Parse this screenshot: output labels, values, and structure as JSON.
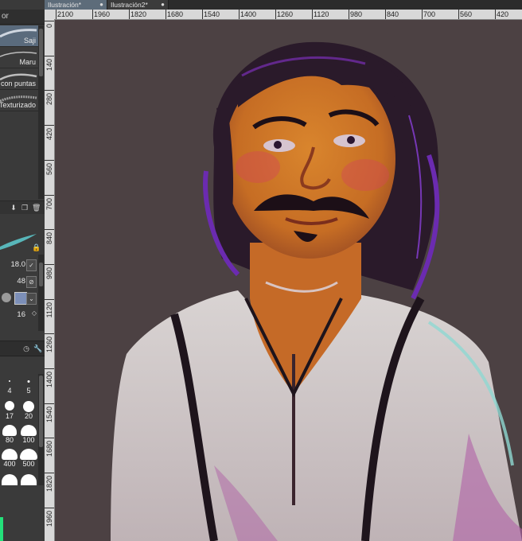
{
  "tabs": [
    {
      "label": "Ilustración*",
      "close": "●",
      "active": true
    },
    {
      "label": "Ilustración2*",
      "close": "●",
      "active": false
    }
  ],
  "ruler_top_labels": [
    "2100",
    "1960",
    "1820",
    "1680",
    "1540",
    "1400",
    "1260",
    "1120",
    "980",
    "840",
    "700",
    "560",
    "420"
  ],
  "ruler_left_labels": [
    "0",
    "140",
    "280",
    "420",
    "560",
    "700",
    "840",
    "980",
    "1120",
    "1260",
    "1400",
    "1540",
    "1680",
    "1820",
    "1960"
  ],
  "left_panel": {
    "header_label": "or",
    "brushes": [
      {
        "label": "Saji",
        "selected": true
      },
      {
        "label": "Maru",
        "selected": false
      },
      {
        "label": "con puntas",
        "selected": false
      },
      {
        "label": "Texturizado",
        "selected": false
      }
    ],
    "properties": [
      {
        "value": "18.0",
        "control": "check"
      },
      {
        "value": "48",
        "control": "none"
      },
      {
        "value": "",
        "control": "texture"
      },
      {
        "value": "16",
        "control": "spin"
      }
    ],
    "size_grid": [
      "4",
      "5",
      "17",
      "20",
      "80",
      "100",
      "400",
      "500"
    ],
    "colors": {
      "selected_brush": "#5a6b7d",
      "indicator": "#23e07a"
    }
  },
  "canvas": {
    "background": "#4c4143"
  }
}
